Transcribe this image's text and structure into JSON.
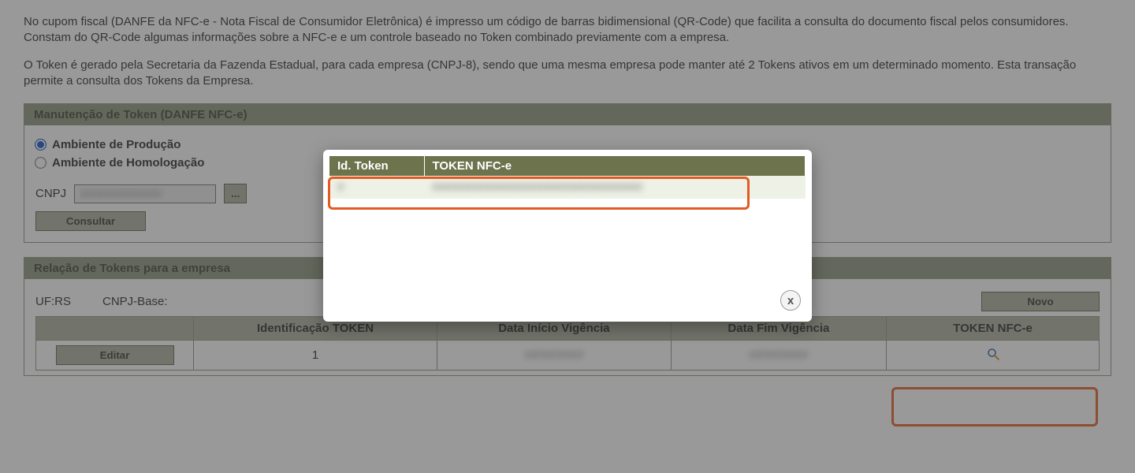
{
  "intro": {
    "p1": "No cupom fiscal (DANFE da NFC-e - Nota Fiscal de Consumidor Eletrônica) é impresso um código de barras bidimensional (QR-Code) que facilita a consulta do documento fiscal pelos consumidores. Constam do QR-Code algumas informações sobre a NFC-e e um controle baseado no Token combinado previamente com a empresa.",
    "p2": "O Token é gerado pela Secretaria da Fazenda Estadual, para cada empresa (CNPJ-8), sendo que uma mesma empresa pode manter até 2 Tokens ativos em um determinado momento. Esta transação permite a consulta dos Tokens da Empresa."
  },
  "panel1": {
    "title": "Manutenção de Token (DANFE NFC-e)",
    "radios": {
      "prod": "Ambiente de Produção",
      "hom": "Ambiente de Homologação"
    },
    "cnpj_label": "CNPJ",
    "cnpj_value": "##############",
    "dots_label": "...",
    "consultar_label": "Consultar"
  },
  "panel2": {
    "title": "Relação de Tokens para a empresa",
    "uf_label": "UF:RS",
    "cnpj_base_label": "CNPJ-Base:",
    "novo_label": "Novo",
    "headers": {
      "blank": "",
      "id": "Identificação TOKEN",
      "ini": "Data Início Vigência",
      "fim": "Data Fim Vigência",
      "tok": "TOKEN NFC-e"
    },
    "row": {
      "edit_label": "Editar",
      "id": "1",
      "ini": "##/##/####",
      "fim": "##/##/####"
    }
  },
  "dialog": {
    "col1": "Id. Token",
    "col2": "TOKEN NFC-e",
    "row_id": "#",
    "row_token": "################################",
    "close": "x"
  }
}
